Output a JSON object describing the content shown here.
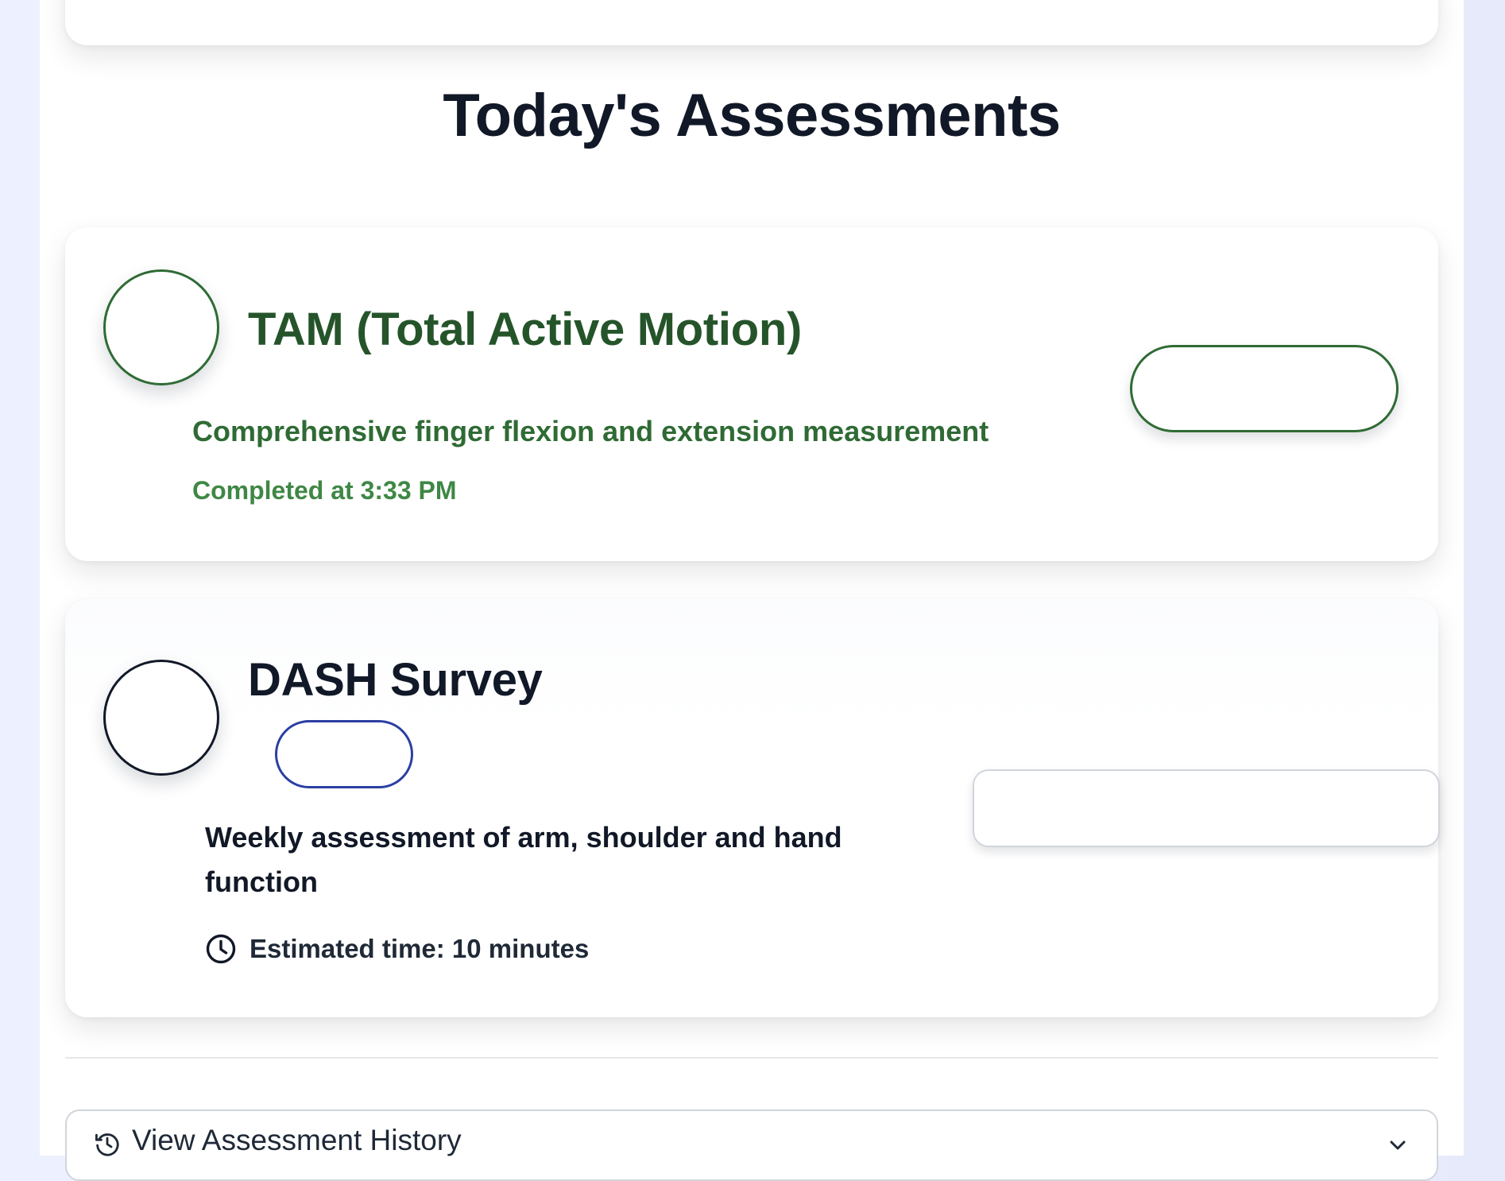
{
  "header": {
    "section_title": "Today's Assessments"
  },
  "assessments": [
    {
      "title": "TAM (Total Active Motion)",
      "description": "Comprehensive finger flexion and extension measurement",
      "status_text": "Completed at 3:33 PM",
      "status": "completed",
      "accent_color": "#2f6b34"
    },
    {
      "title": "DASH Survey",
      "description": "Weekly assessment of arm, shoulder and hand function",
      "time_text": "Estimated time: 10 minutes",
      "time_icon": "clock-icon",
      "status": "pending",
      "badge_color": "#2b3fa3"
    }
  ],
  "history": {
    "label": "View Assessment History",
    "icon": "history-icon",
    "toggle_icon": "chevron-down-icon"
  }
}
